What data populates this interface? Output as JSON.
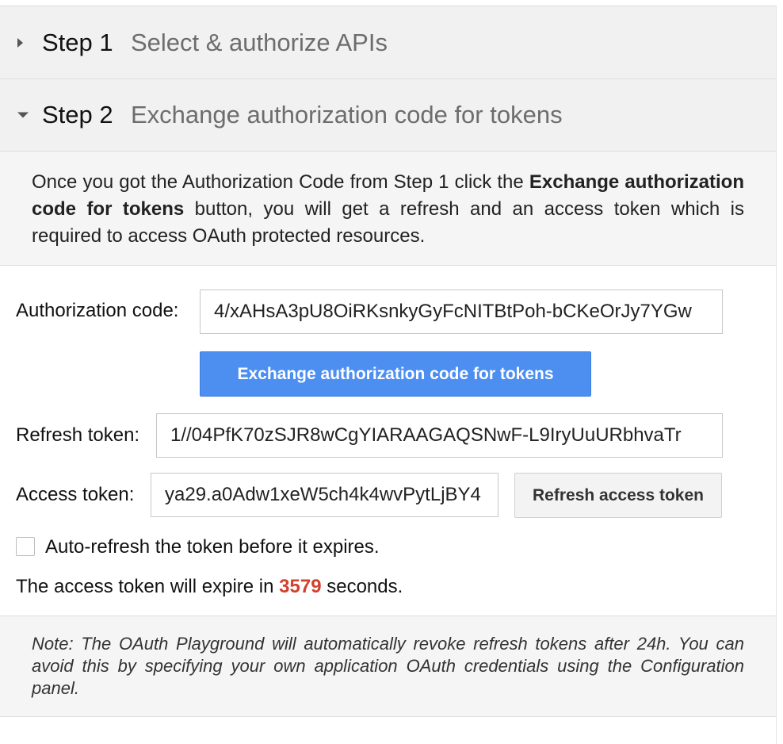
{
  "step1": {
    "number": "Step 1",
    "title": "Select & authorize APIs",
    "expanded": false
  },
  "step2": {
    "number": "Step 2",
    "title": "Exchange authorization code for tokens",
    "expanded": true,
    "description": {
      "part1": "Once you got the Authorization Code from Step 1 click the ",
      "bold": "Exchange authorization code for tokens",
      "part2": " button, you will get a refresh and an access token which is required to access OAuth protected resources."
    },
    "authorization_code": {
      "label": "Authorization code:",
      "value": "4/xAHsA3pU8OiRKsnkyGyFcNITBtPoh-bCKeOrJy7YGw"
    },
    "exchange_button_label": "Exchange authorization code for tokens",
    "refresh_token": {
      "label": "Refresh token:",
      "value": "1//04PfK70zSJR8wCgYIARAAGAQSNwF-L9IryUuURbhvaTr"
    },
    "access_token": {
      "label": "Access token:",
      "value": "ya29.a0Adw1xeW5ch4k4wvPytLjBY4"
    },
    "refresh_button_label": "Refresh access token",
    "auto_refresh": {
      "label": "Auto-refresh the token before it expires.",
      "checked": false
    },
    "expiry": {
      "prefix": "The access token will expire in ",
      "seconds": "3579",
      "suffix": " seconds."
    },
    "note": "Note: The OAuth Playground will automatically revoke refresh tokens after 24h. You can avoid this by specifying your own application OAuth credentials using the Configuration panel."
  },
  "colors": {
    "primary_button": "#4d8ff1",
    "expiry_count": "#d2402f",
    "header_bg": "#f1f1f1"
  }
}
